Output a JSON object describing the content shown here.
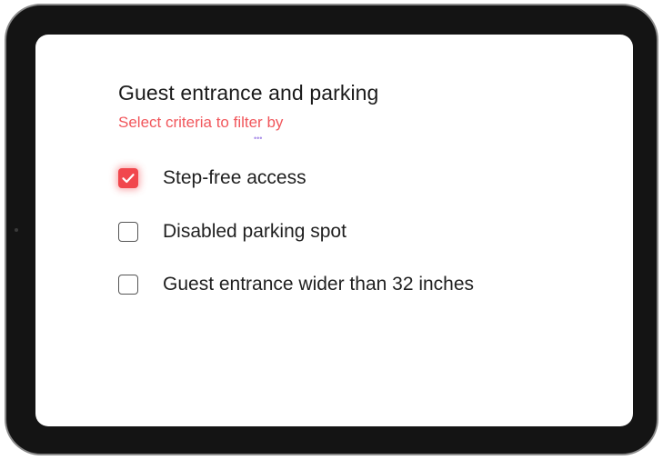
{
  "form": {
    "title": "Guest entrance and parking",
    "subtitle": "Select criteria to filter by",
    "dots": "•••",
    "options": [
      {
        "label": "Step-free access",
        "checked": true
      },
      {
        "label": "Disabled parking spot",
        "checked": false
      },
      {
        "label": "Guest entrance wider than 32 inches",
        "checked": false
      }
    ]
  },
  "colors": {
    "accent": "#f1474d",
    "subtitle": "#f1575c",
    "device_frame": "#141414"
  },
  "icons": {
    "checked_box": "checkmark-icon"
  }
}
